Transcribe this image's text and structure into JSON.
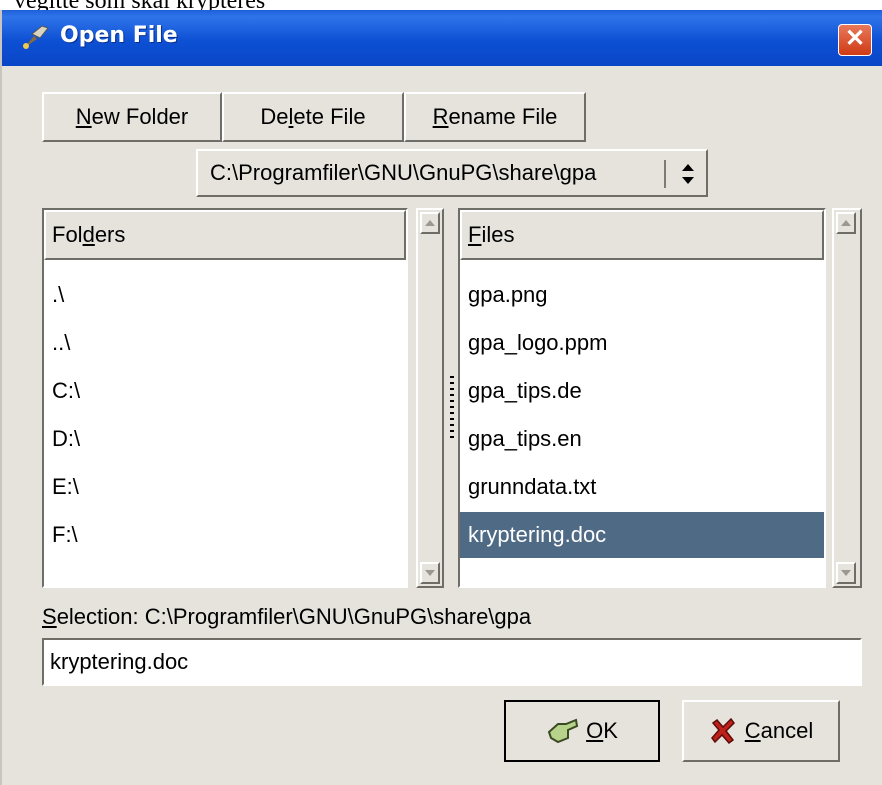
{
  "caption": "vegitte som skal krypteres",
  "window": {
    "title": "Open File",
    "close": "✕"
  },
  "toolbar": {
    "new_folder": {
      "mnemonic": "N",
      "rest": "ew Folder"
    },
    "delete_file": {
      "pre": "De",
      "mnemonic": "l",
      "rest": "ete File"
    },
    "rename_file": {
      "mnemonic": "R",
      "rest": "ename File"
    }
  },
  "path_combo": {
    "value": "C:\\Programfiler\\GNU\\GnuPG\\share\\gpa"
  },
  "folders": {
    "header": {
      "pre": "Fol",
      "mnemonic": "d",
      "rest": "ers"
    },
    "items": [
      ".\\",
      "..\\",
      "C:\\",
      "D:\\",
      "E:\\",
      "F:\\"
    ]
  },
  "files": {
    "header": {
      "mnemonic": "F",
      "rest": "iles"
    },
    "items": [
      "gpa.png",
      "gpa_logo.ppm",
      "gpa_tips.de",
      "gpa_tips.en",
      "grunndata.txt",
      "kryptering.doc"
    ],
    "selected_index": 5
  },
  "selection": {
    "label_mnemonic": "S",
    "label_rest": "election:",
    "path": "C:\\Programfiler\\GNU\\GnuPG\\share\\gpa",
    "filename": "kryptering.doc"
  },
  "actions": {
    "ok": {
      "mnemonic": "O",
      "rest": "K"
    },
    "cancel": {
      "mnemonic": "C",
      "rest": "ancel"
    }
  },
  "colors": {
    "selection_bg": "#4e6a85",
    "dialog_bg": "#e5e3dc",
    "titlebar": "#0a46c7"
  }
}
